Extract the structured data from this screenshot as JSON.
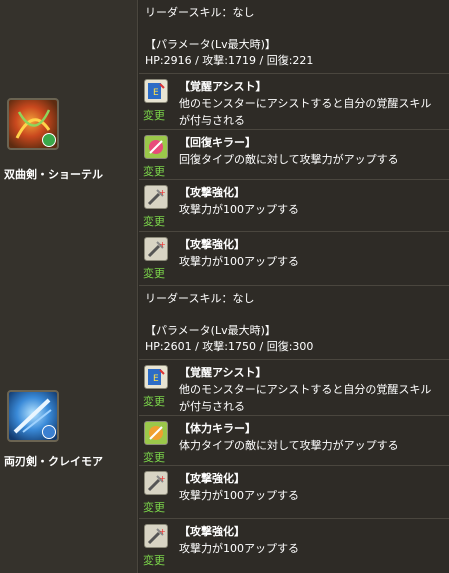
{
  "monsters": [
    {
      "name": "双曲剣・ショーテル",
      "attribute_color": "#3aa84a",
      "leader_skill": "リーダースキル：なし",
      "params_header": "【パラメータ(Lv最大時)】",
      "params": "HP:2916 / 攻撃:1719 / 回復:221",
      "awakenings": [
        {
          "icon": "awaken-assist-icon",
          "title": "【覚醒アシスト】",
          "desc": "他のモンスターにアシストすると自分の覚醒スキル\nが付与される",
          "change": "変更"
        },
        {
          "icon": "recover-killer-icon",
          "title": "【回復キラー】",
          "desc": "回復タイプの敵に対して攻撃力がアップする",
          "change": "変更"
        },
        {
          "icon": "attack-boost-icon",
          "title": "【攻撃強化】",
          "desc": "攻撃力が100アップする",
          "change": "変更"
        },
        {
          "icon": "attack-boost-icon",
          "title": "【攻撃強化】",
          "desc": "攻撃力が100アップする",
          "change": "変更"
        }
      ]
    },
    {
      "name": "両刃剣・クレイモア",
      "attribute_color": "#3a7fd0",
      "leader_skill": "リーダースキル：なし",
      "params_header": "【パラメータ(Lv最大時)】",
      "params": "HP:2601 / 攻撃:1750 / 回復:300",
      "awakenings": [
        {
          "icon": "awaken-assist-icon",
          "title": "【覚醒アシスト】",
          "desc": "他のモンスターにアシストすると自分の覚醒スキル\nが付与される",
          "change": "変更"
        },
        {
          "icon": "health-killer-icon",
          "title": "【体力キラー】",
          "desc": "体力タイプの敵に対して攻撃力がアップする",
          "change": "変更"
        },
        {
          "icon": "attack-boost-icon",
          "title": "【攻撃強化】",
          "desc": "攻撃力が100アップする",
          "change": "変更"
        },
        {
          "icon": "attack-boost-icon",
          "title": "【攻撃強化】",
          "desc": "攻撃力が100アップする",
          "change": "変更"
        }
      ]
    }
  ]
}
